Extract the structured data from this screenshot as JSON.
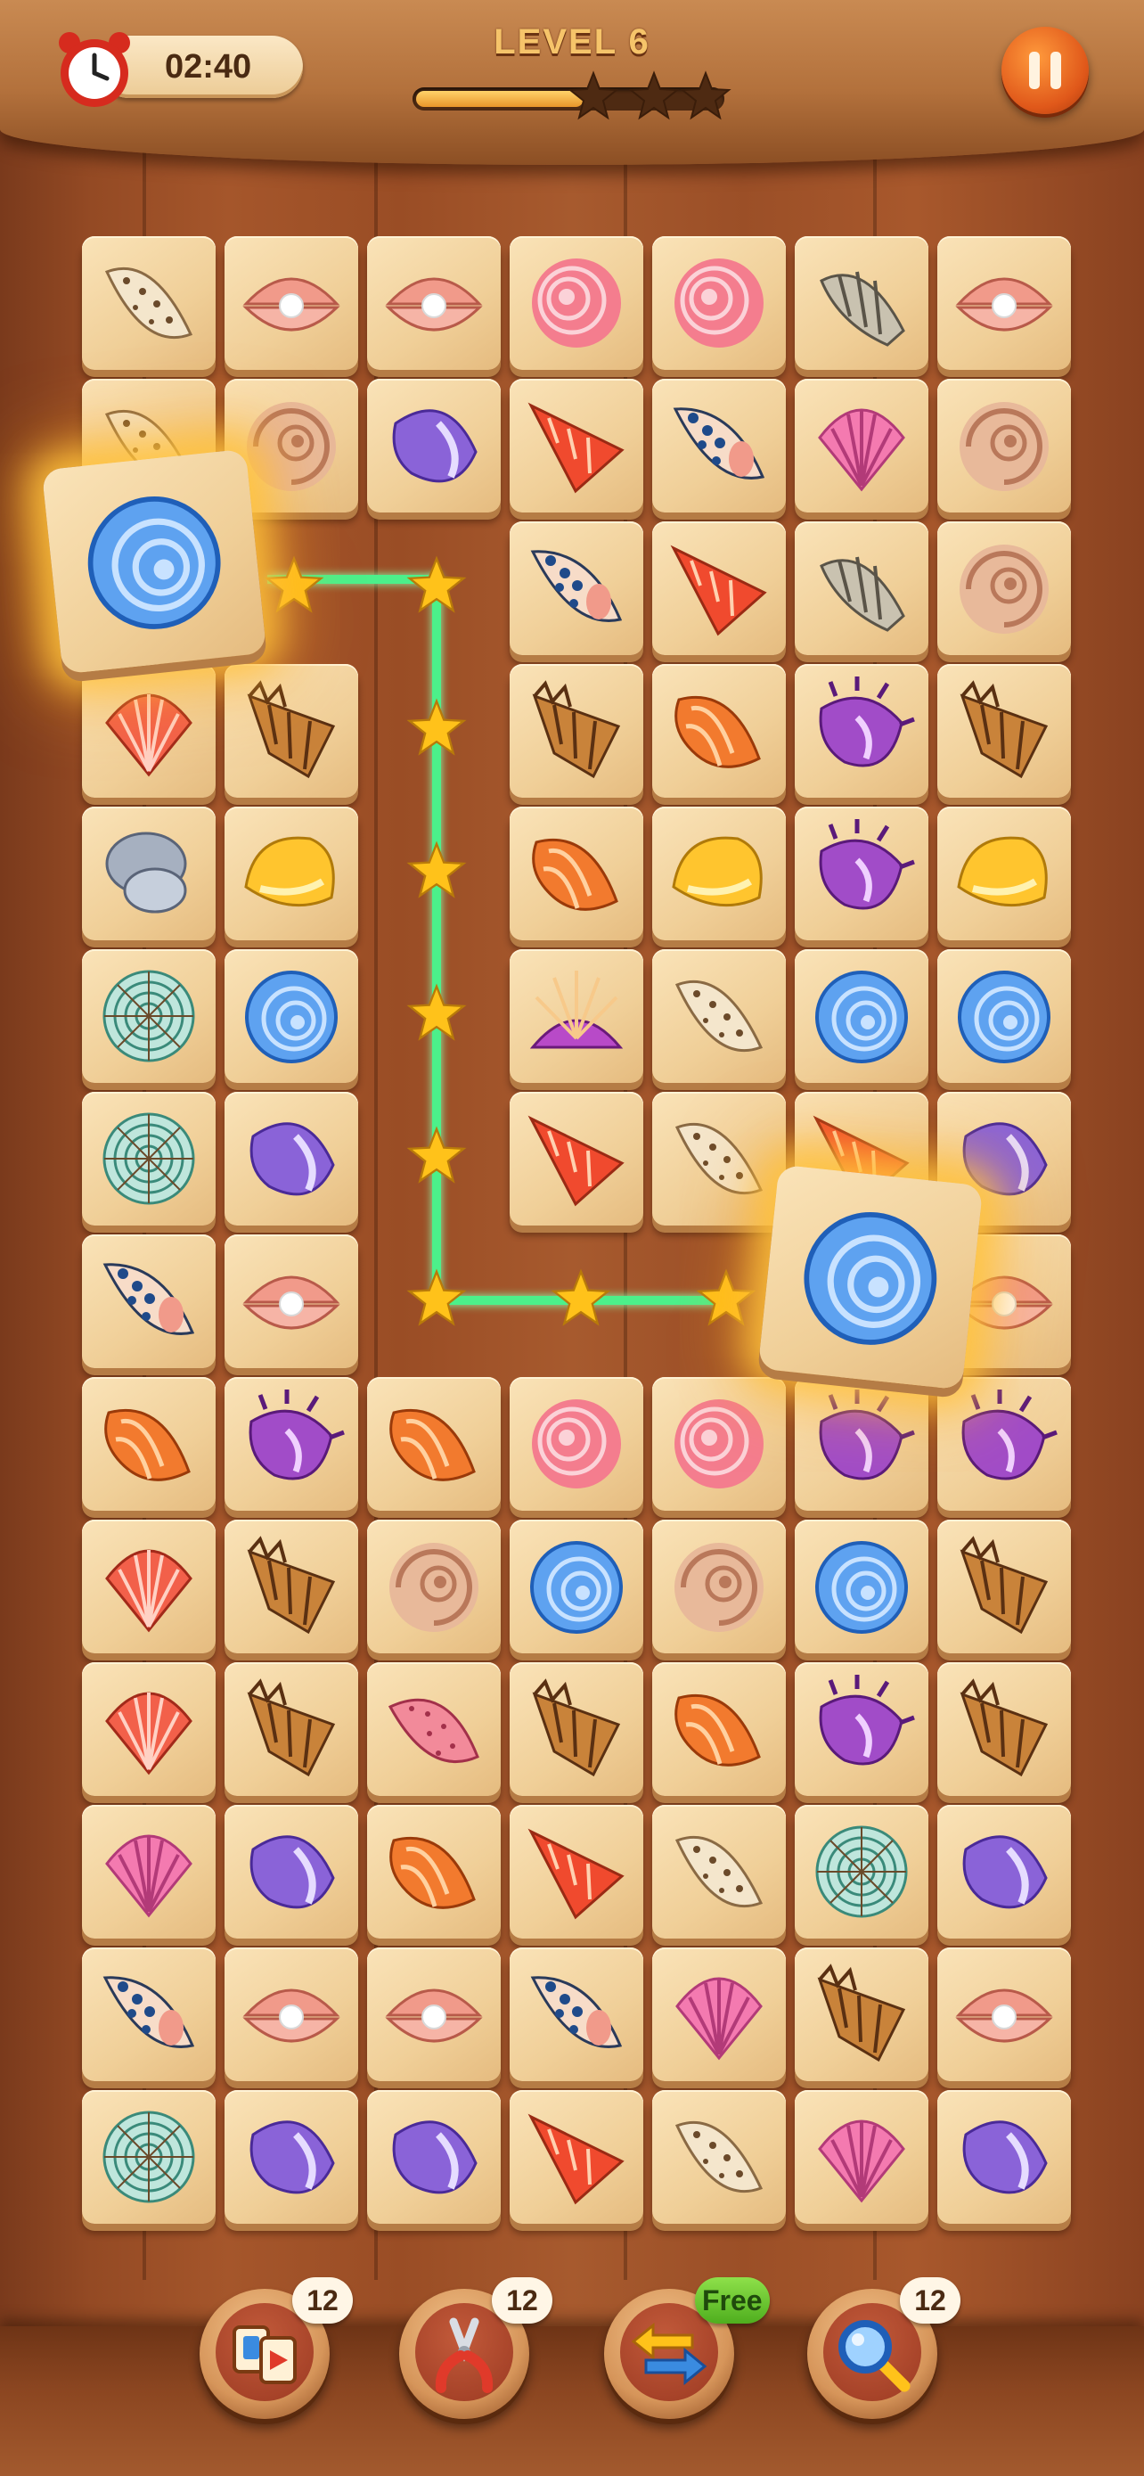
{
  "header": {
    "timer": "02:40",
    "level_label": "LEVEL 6",
    "level_progress": 0.55,
    "stars_earned": 0,
    "stars_total": 3
  },
  "board": {
    "columns": 7,
    "rows": 14,
    "tiles": [
      [
        "spotted-cone",
        "pearl-clam",
        "pearl-clam",
        "pink-spiral",
        "pink-spiral",
        "gray-whelk",
        "pearl-clam"
      ],
      [
        "spotted-cone",
        "tan-nautilus",
        "purple-conch",
        "red-spire",
        "blue-cone",
        "pink-scallop",
        "tan-nautilus"
      ],
      [
        "blue-ammonite",
        "",
        "",
        "blue-cone",
        "red-spire",
        "gray-whelk",
        "tan-nautilus"
      ],
      [
        "red-scallop",
        "brown-murex",
        "",
        "brown-murex",
        "orange-snail",
        "purple-murex",
        "brown-murex"
      ],
      [
        "gray-pebble",
        "yellow-helmet",
        "",
        "orange-snail",
        "yellow-helmet",
        "purple-murex",
        "yellow-helmet"
      ],
      [
        "teal-spiral",
        "blue-ammonite",
        "",
        "sunray-shell",
        "spotted-cone",
        "blue-ammonite",
        "blue-ammonite"
      ],
      [
        "teal-spiral",
        "purple-conch",
        "",
        "red-spire",
        "spotted-cone",
        "red-spire",
        "purple-conch"
      ],
      [
        "blue-cone",
        "pearl-clam",
        "",
        "",
        "",
        "blue-ammonite",
        "pearl-clam"
      ],
      [
        "orange-snail",
        "purple-murex",
        "orange-snail",
        "pink-spiral",
        "pink-spiral",
        "purple-murex",
        "purple-murex"
      ],
      [
        "red-scallop",
        "brown-murex",
        "tan-nautilus",
        "blue-ammonite",
        "tan-nautilus",
        "blue-ammonite",
        "brown-murex"
      ],
      [
        "red-scallop",
        "brown-murex",
        "pink-cone",
        "brown-murex",
        "orange-snail",
        "purple-murex",
        "brown-murex"
      ],
      [
        "pink-scallop",
        "purple-conch",
        "orange-snail",
        "red-spire",
        "spotted-cone",
        "teal-spiral",
        "purple-conch"
      ],
      [
        "blue-cone",
        "pearl-clam",
        "pearl-clam",
        "blue-cone",
        "pink-scallop",
        "brown-murex",
        "pearl-clam"
      ],
      [
        "teal-spiral",
        "purple-conch",
        "purple-conch",
        "red-spire",
        "spotted-cone",
        "pink-scallop",
        "purple-conch"
      ]
    ],
    "selected_match": {
      "tile": "blue-ammonite"
    }
  },
  "tools": [
    {
      "name": "shuffle-tiles",
      "icon": "shuffle-cards-icon",
      "count": "12"
    },
    {
      "name": "remove-pair",
      "icon": "pliers-icon",
      "count": "12"
    },
    {
      "name": "swap",
      "icon": "swap-arrows-icon",
      "count": "Free"
    },
    {
      "name": "hint",
      "icon": "magnifier-icon",
      "count": "12"
    }
  ],
  "colors": {
    "accent": "#e0581a",
    "link_line": "#4cf08a",
    "star": "#ffc21a"
  }
}
